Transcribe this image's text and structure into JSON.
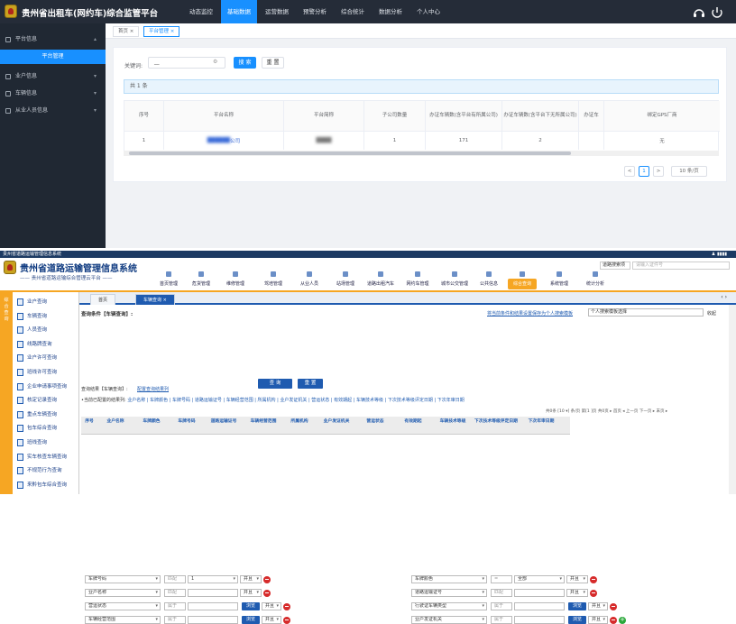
{
  "top": {
    "title": "贵州省出租车(网约车)综合监管平台",
    "nav": [
      "动态监控",
      "基础数据",
      "运营数据",
      "预警分析",
      "综合统计",
      "数据分析",
      "个人中心"
    ],
    "active_nav": "基础数据",
    "sidebar": [
      {
        "label": "平台信息",
        "expanded": true
      },
      {
        "label": "平台管理",
        "sub": true
      },
      {
        "label": "业户信息"
      },
      {
        "label": "车辆信息"
      },
      {
        "label": "从业人员信息"
      }
    ],
    "tabs": [
      {
        "label": "首页 ×"
      },
      {
        "label": "平台管理 ×",
        "active": true
      }
    ],
    "keyword_label": "关键词:",
    "keyword_value": "__",
    "search_label": "搜 索",
    "reset_label": "重 置",
    "count_text": "共 1 条",
    "table_headers": [
      "序号",
      "平台名称",
      "平台简称",
      "子公司数量",
      "办证车辆数(含平台有所属公司)",
      "办证车辆数(含平台下无所属公司)",
      "办证车",
      "绑定GPS厂商"
    ],
    "row": {
      "index": "1",
      "name": "公司",
      "short": "",
      "sub_count": "1",
      "vehicles_with": "171",
      "vehicles_without": "2",
      "extra": "",
      "gps": "无"
    },
    "pager": {
      "prev": "<",
      "page": "1",
      "next": ">",
      "size": "10 条/页"
    }
  },
  "bottom": {
    "window_title": "贵州省道路运输管理信息系统",
    "title": "贵州省道路运输管理信息系统",
    "subtitle": "—— 贵州省道路运输综合管理云平台 ——",
    "nav_select": "道路搜索项",
    "nav_input_placeholder": "请输入证件号",
    "nav": [
      "首页管理",
      "危货管理",
      "维修管理",
      "驾培管理",
      "从业人员",
      "站场管理",
      "道路出租汽车",
      "网约车管理",
      "城市公交管理",
      "公共信息",
      "综合查询",
      "系统管理",
      "统计分析"
    ],
    "active_nav": "综合查询",
    "left_strip": [
      "综",
      "合",
      "查",
      "询"
    ],
    "sidebar": [
      "业户查询",
      "车辆查询",
      "人员查询",
      "线路牌查询",
      "业户许可查询",
      "班线许可查询",
      "企业申请事项查询",
      "核定记录查询",
      "重点车辆查询",
      "包车综合查询",
      "班线查询",
      "实车核查车辆查询",
      "不规范行为查询",
      "来黔包车综合查询"
    ],
    "tabs": [
      {
        "label": "首页"
      },
      {
        "label": "车辆查询 ×",
        "active": true
      }
    ],
    "cond_title": "查询条件【车辆查询】:",
    "cond_link": "将当前条件和结果设置保存为个人搜索模板",
    "my_search": "个人搜索模板选择",
    "collapse": "收起",
    "rows": [
      {
        "left": {
          "field": "车牌号码",
          "op": "匹配",
          "value": "1",
          "logic": "并且"
        },
        "right": {
          "field": "车牌颜色",
          "op": "=",
          "value": "全部",
          "logic": "并且"
        }
      },
      {
        "left": {
          "field": "业户名称",
          "op": "匹配",
          "logic": "并且"
        },
        "right": {
          "field": "道路运输证号",
          "op": "匹配",
          "logic": "并且"
        }
      },
      {
        "left": {
          "field": "营运状态",
          "op": "属于",
          "btn": "浏览",
          "logic": "并且"
        },
        "right": {
          "field": "行驶证车辆类型",
          "op": "属于",
          "btn": "浏览",
          "logic": "并且"
        }
      },
      {
        "left": {
          "field": "车辆经营范围",
          "op": "属于",
          "btn": "浏览",
          "logic": "并且"
        },
        "right": {
          "field": "业户发证机关",
          "op": "属于",
          "btn": "浏览",
          "logic": "并且"
        }
      }
    ],
    "query_label": "查 询",
    "reset_label": "重 置",
    "result_label": "查询结果【车辆查询】:",
    "result_link": "配置查询结果列",
    "cfg_prefix": "•当前已配置的结果列:",
    "cfg_items": "业户名称 | 车牌颜色 | 车牌号码 | 道路运输证号 | 车辆经营范围 | 所属机构 | 业户发证机关 | 营运状态 | 有效期起 | 车辆技术等级 | 下次技术等级评定日期 | 下次年审日期",
    "grid_tool": "共0条 [10 ▾] 条/页 第[1 ]页 共0页 ▸ 首页 ◂ 上一页 下一页 ▸ 末页 ▸",
    "grid_headers": [
      "序号",
      "业户名称",
      "车牌颜色",
      "车牌号码",
      "道路运输证号",
      "车辆经营范围",
      "所属机构",
      "业户发证机关",
      "营运状态",
      "有效期起",
      "车辆技术等级",
      "下次技术等级评定日期",
      "下次年审日期"
    ]
  }
}
